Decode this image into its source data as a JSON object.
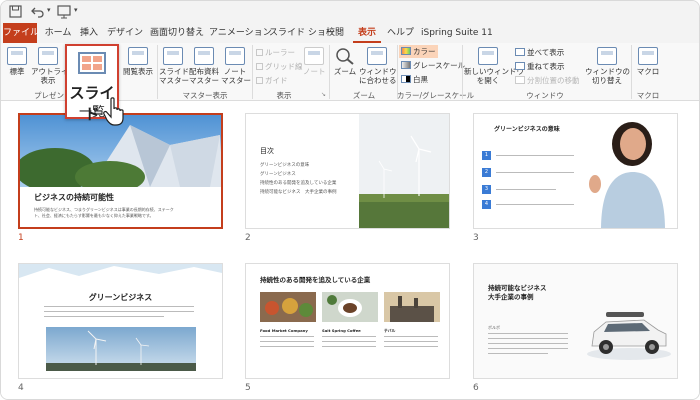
{
  "ribbon_tabs": [
    "ファイル",
    "ホーム",
    "挿入",
    "デザイン",
    "画面切り替え",
    "アニメーション",
    "スライド ショー",
    "校閲",
    "表示",
    "ヘルプ",
    "iSpring Suite 11"
  ],
  "ribbon": {
    "normal": "標準",
    "outline": [
      "アウトライン",
      "表示"
    ],
    "reading": "閲覧表示",
    "slide_master": [
      "スライド",
      "マスター"
    ],
    "handout_master": [
      "配布資料",
      "マスター"
    ],
    "notes_master": [
      "ノート",
      "マスター"
    ],
    "ruler": "ルーラー",
    "gridlines": "グリッド線",
    "guides": "ガイド",
    "notes": "ノート",
    "zoom": "ズーム",
    "fit": [
      "ウィンドウ",
      "に合わせる"
    ],
    "color": "カラー",
    "grayscale": "グレースケール",
    "bw": "白黒",
    "new_window": [
      "新しいウィンドウ",
      "を開く"
    ],
    "arrange": "並べて表示",
    "cascade": "重ねて表示",
    "move_split": "分割位置の移動",
    "switch_windows": [
      "ウィンドウの",
      "切り替え"
    ],
    "macros": "マクロ",
    "groups": {
      "presentation": "プレゼン",
      "master": "マスター表示",
      "show": "表示",
      "zoom": "ズーム",
      "color": "カラー/グレースケール",
      "window": "ウィンドウ",
      "macro": "マクロ"
    },
    "highlight": [
      "スライド",
      "一覧"
    ]
  },
  "slides": [
    {
      "n": "1",
      "title": "ビジネスの持続可能性",
      "body": [
        "持続可能なビジネス、つまりグリーンビジネスは事業の長期的存続、ステーク",
        "ト、社会、経済にもたらす影響を最も少なく抑えた事業戦略です。"
      ]
    },
    {
      "n": "2",
      "title": "目次",
      "items": [
        "グリーンビジネスの意味",
        "グリーンビジネス",
        "持続性のある開発を追及している企業",
        "持続可能なビジネス　大手企業の事例"
      ]
    },
    {
      "n": "3",
      "title": "グリーンビジネスの意味",
      "steps": [
        "1",
        "2",
        "3",
        "4"
      ]
    },
    {
      "n": "4",
      "title": "グリーンビジネス"
    },
    {
      "n": "5",
      "title": "持続性のある開発を追及している企業",
      "cols": [
        "Food Market Company",
        "Salt Spring Coffee",
        "テバル"
      ]
    },
    {
      "n": "6",
      "title": [
        "持続可能なビジネス",
        "大手企業の事例"
      ],
      "sub": "ボルボ"
    }
  ]
}
